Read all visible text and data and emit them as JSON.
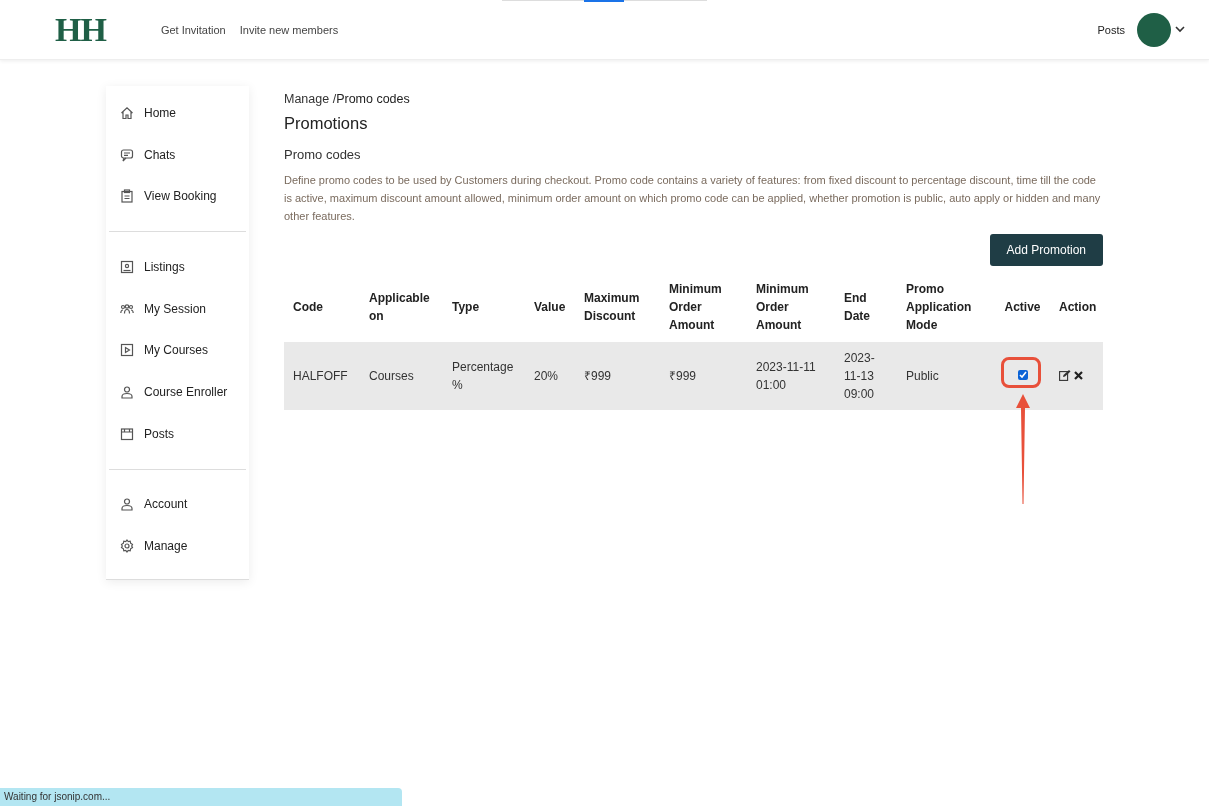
{
  "header": {
    "logo": "HH",
    "nav": [
      "Get Invitation",
      "Invite new members"
    ],
    "right_link": "Posts"
  },
  "sidebar": {
    "groups": [
      [
        {
          "label": "Home",
          "kind": "home"
        },
        {
          "label": "Chats",
          "kind": "chat"
        },
        {
          "label": "View Booking",
          "kind": "clipboard"
        }
      ],
      [
        {
          "label": "Listings",
          "kind": "listing"
        },
        {
          "label": "My Session",
          "kind": "people"
        },
        {
          "label": "My Courses",
          "kind": "play"
        },
        {
          "label": "Course Enroller",
          "kind": "person"
        },
        {
          "label": "Posts",
          "kind": "calendar"
        }
      ],
      [
        {
          "label": "Account",
          "kind": "person"
        },
        {
          "label": "Manage",
          "kind": "gear"
        }
      ]
    ]
  },
  "breadcrumb": {
    "parent": "Manage /",
    "current": "Promo codes"
  },
  "title": "Promotions",
  "subtitle": "Promo codes",
  "description": "Define promo codes to be used by Customers during checkout. Promo code contains a variety of features: from fixed discount to percentage discount, time till the code is active, maximum discount amount allowed, minimum order amount on which promo code can be applied, whether promotion is public, auto apply or hidden and many other features.",
  "add_button": "Add Promotion",
  "table": {
    "columns": [
      "Code",
      "Applicable on",
      "Type",
      "Value",
      "Maximum Discount",
      "Minimum Order Amount",
      "Minimum Order Amount",
      "End Date",
      "Promo Application Mode",
      "Active",
      "Action"
    ],
    "rows": [
      {
        "cells": [
          "HALFOFF",
          "Courses",
          "Percentage %",
          "20%",
          "₹999",
          "₹999",
          "2023-11-11 01:00",
          "2023-11-13 09:00",
          "Public"
        ],
        "active": true,
        "highlighted": true
      }
    ]
  },
  "status_bar": "Waiting for jsonip.com..."
}
